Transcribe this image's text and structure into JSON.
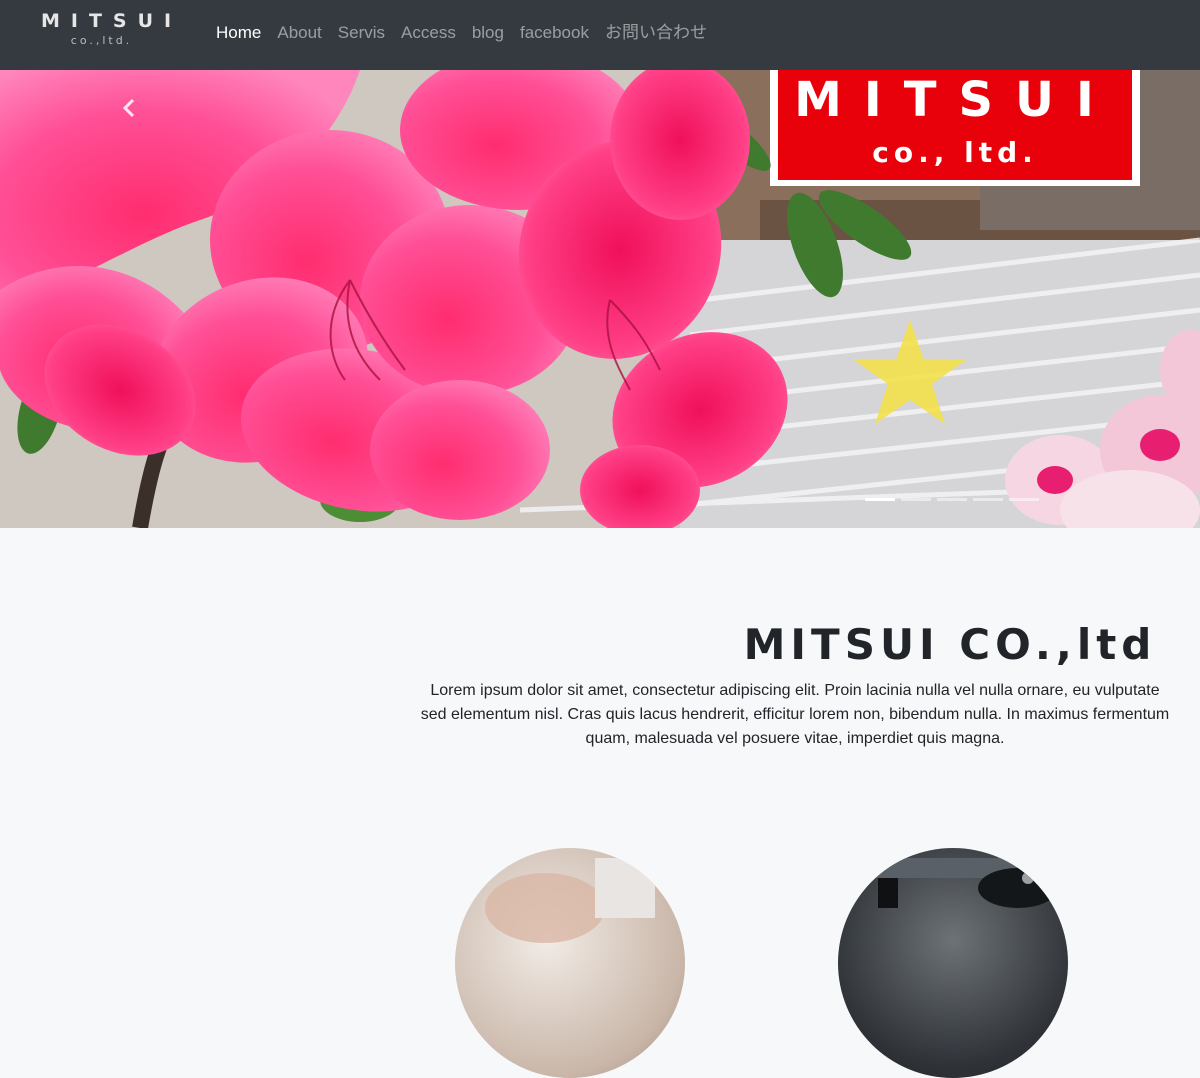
{
  "navbar": {
    "brand_main": "MITSUI",
    "brand_sub": "co.,ltd.",
    "links": [
      "Home",
      "About",
      "Servis",
      "Access",
      "blog",
      "facebook",
      "お問い合わせ"
    ],
    "active_index": 0
  },
  "hero": {
    "sign_main": "MITSUI",
    "sign_sub": "co., ltd.",
    "slide_count": 5,
    "active_slide": 0
  },
  "main": {
    "title": "MITSUI CO.,ltd",
    "lead_lines": [
      "Lorem ipsum dolor sit amet, consectetur adipiscing elit. Proin lacinia nulla vel nulla ornare, eu vulputate",
      "sed elementum nisl. Cras quis lacus hendrerit, efficitur lorem non, bibendum nulla. In maximus fermentum",
      "quam, malesuada vel posuere vitae, imperdiet quis magna."
    ]
  },
  "colors": {
    "navbar_bg": "#343a40",
    "page_bg": "#f7f8fa",
    "sign_red": "#e8000b"
  }
}
